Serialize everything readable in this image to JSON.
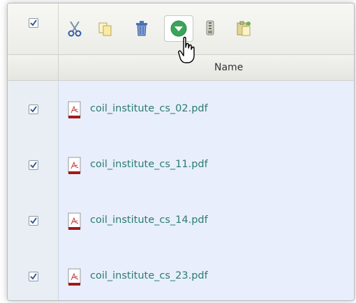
{
  "toolbar": {
    "icons": [
      "select-all-checkbox",
      "scissors-icon",
      "copy-icon",
      "trash-icon",
      "download-icon",
      "zip-icon",
      "paste-icon"
    ]
  },
  "table": {
    "column_header": "Name",
    "rows": [
      {
        "file": "coil_institute_cs_02.pdf",
        "checked": true
      },
      {
        "file": "coil_institute_cs_11.pdf",
        "checked": true
      },
      {
        "file": "coil_institute_cs_14.pdf",
        "checked": true
      },
      {
        "file": "coil_institute_cs_23.pdf",
        "checked": true
      }
    ]
  },
  "colors": {
    "file_link": "#2c7a74",
    "list_bg": "#e8eefb",
    "download_green": "#3aa55a",
    "pdf_red": "#a01a1a"
  }
}
